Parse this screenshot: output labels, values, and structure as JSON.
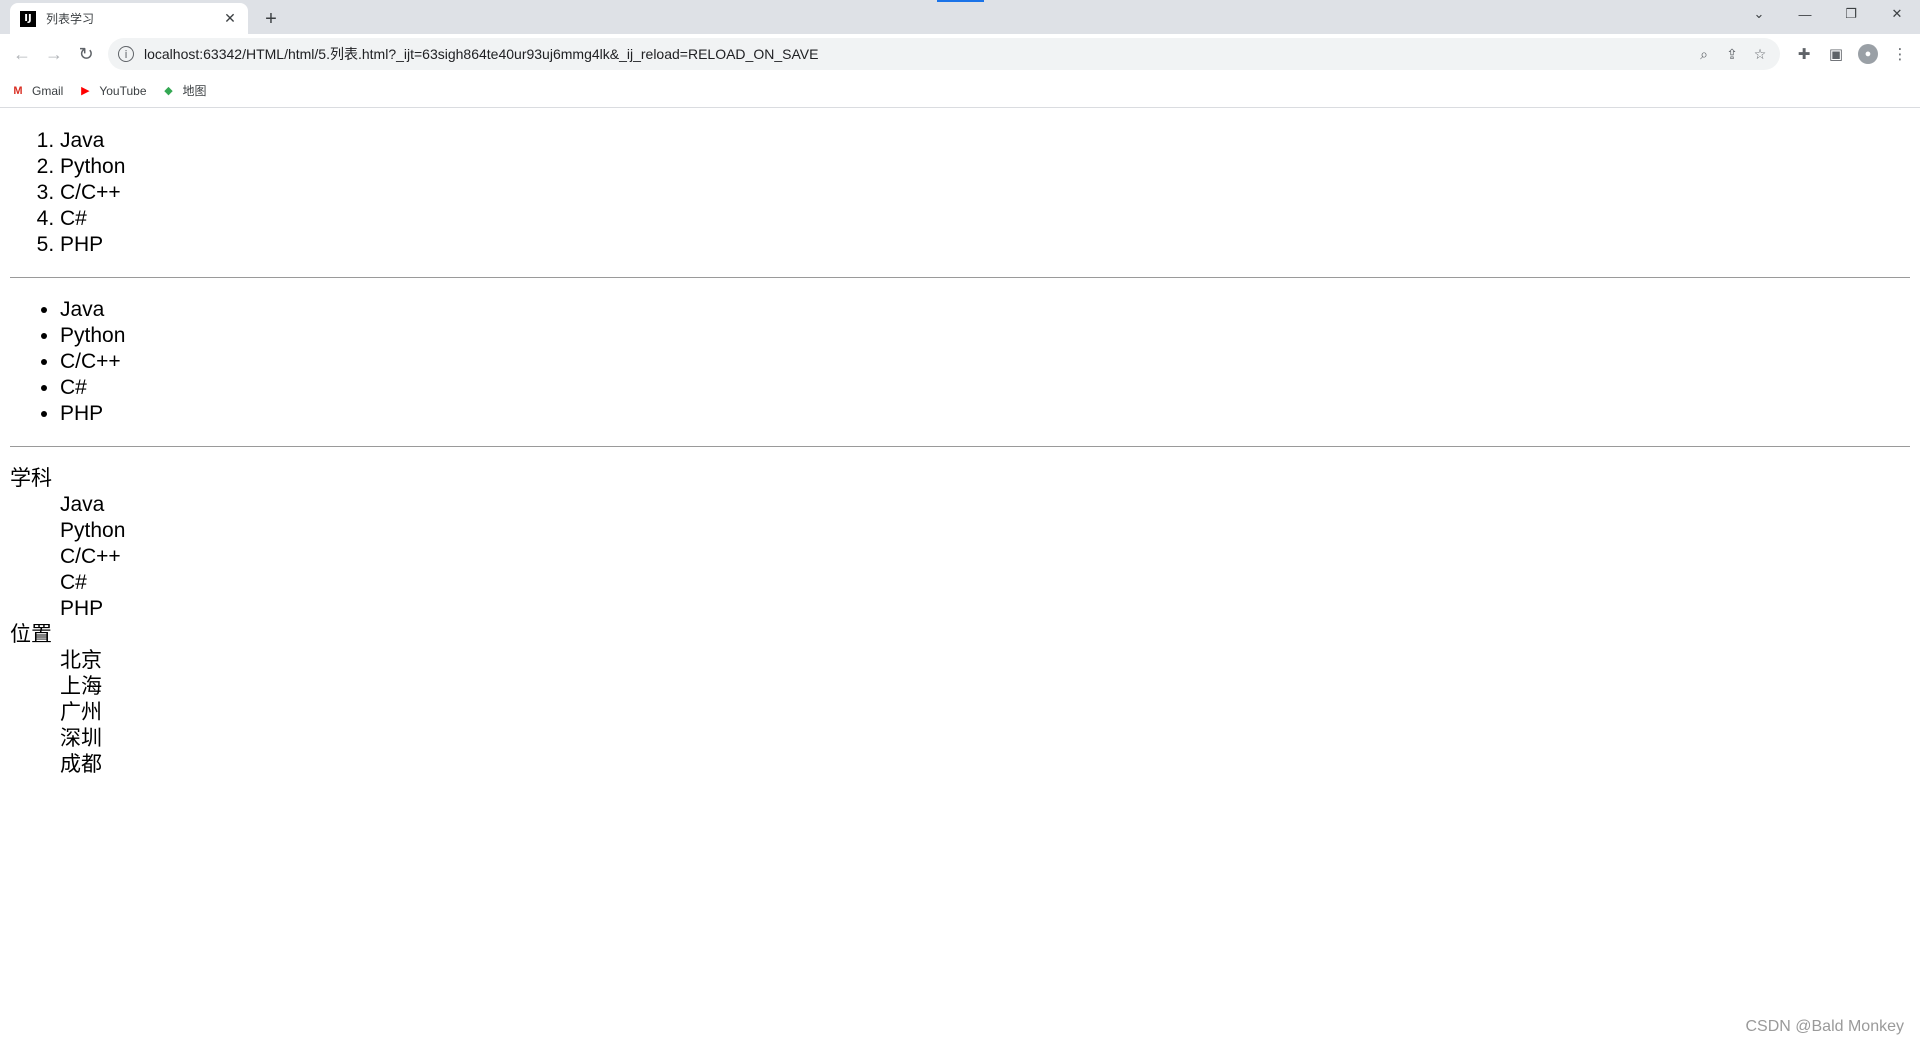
{
  "browser": {
    "tab": {
      "title": "列表学习",
      "favicon": "intellij-icon"
    },
    "window_controls": [
      "chevron-down-icon",
      "minimize-icon",
      "restore-icon",
      "close-icon"
    ],
    "url": "localhost:63342/HTML/html/5.列表.html?_ijt=63sigh864te40ur93uj6mmg4lk&_ij_reload=RELOAD_ON_SAVE",
    "bookmarks": [
      {
        "label": "Gmail",
        "icon": "gmail-icon",
        "color": "#d93025"
      },
      {
        "label": "YouTube",
        "icon": "youtube-icon",
        "color": "#ff0000"
      },
      {
        "label": "地图",
        "icon": "maps-icon",
        "color": "#34a853"
      }
    ]
  },
  "page": {
    "ordered_list": [
      "Java",
      "Python",
      "C/C++",
      "C#",
      "PHP"
    ],
    "unordered_list": [
      "Java",
      "Python",
      "C/C++",
      "C#",
      "PHP"
    ],
    "definition_list": [
      {
        "term": "学科",
        "definitions": [
          "Java",
          "Python",
          "C/C++",
          "C#",
          "PHP"
        ]
      },
      {
        "term": "位置",
        "definitions": [
          "北京",
          "上海",
          "广州",
          "深圳",
          "成都"
        ]
      }
    ]
  },
  "watermark": "CSDN @Bald Monkey"
}
